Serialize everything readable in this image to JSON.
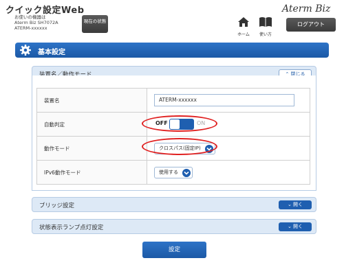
{
  "header": {
    "app_title": "クイック設定Web",
    "device_line1": "お使いの機器は",
    "device_line2": "Aterm Biz SH7072A",
    "device_line3": "ATERM-xxxxxx",
    "status_button": "現在の状態",
    "home_label": "ホーム",
    "help_label": "使い方",
    "brand": "Aterm Biz",
    "logout_button": "ログアウト"
  },
  "section": {
    "title": "基本設定"
  },
  "panel_device": {
    "title": "装置名／動作モード",
    "close_button": "閉じる",
    "rows": [
      {
        "label": "装置名",
        "value": "ATERM-xxxxxx"
      },
      {
        "label": "自動判定",
        "off": "OFF",
        "on": "ON"
      },
      {
        "label": "動作モード",
        "value": "クロスパス(固定IP)"
      },
      {
        "label": "IPv6動作モード",
        "value": "使用する"
      }
    ]
  },
  "panel_bridge": {
    "title": "ブリッジ設定",
    "open_button": "開く"
  },
  "panel_lamp": {
    "title": "状態表示ランプ点灯設定",
    "open_button": "開く"
  },
  "apply_button": "設定",
  "colors": {
    "accent": "#1c59a6",
    "highlight": "#e02020",
    "panel_bg": "#dde9f6"
  }
}
